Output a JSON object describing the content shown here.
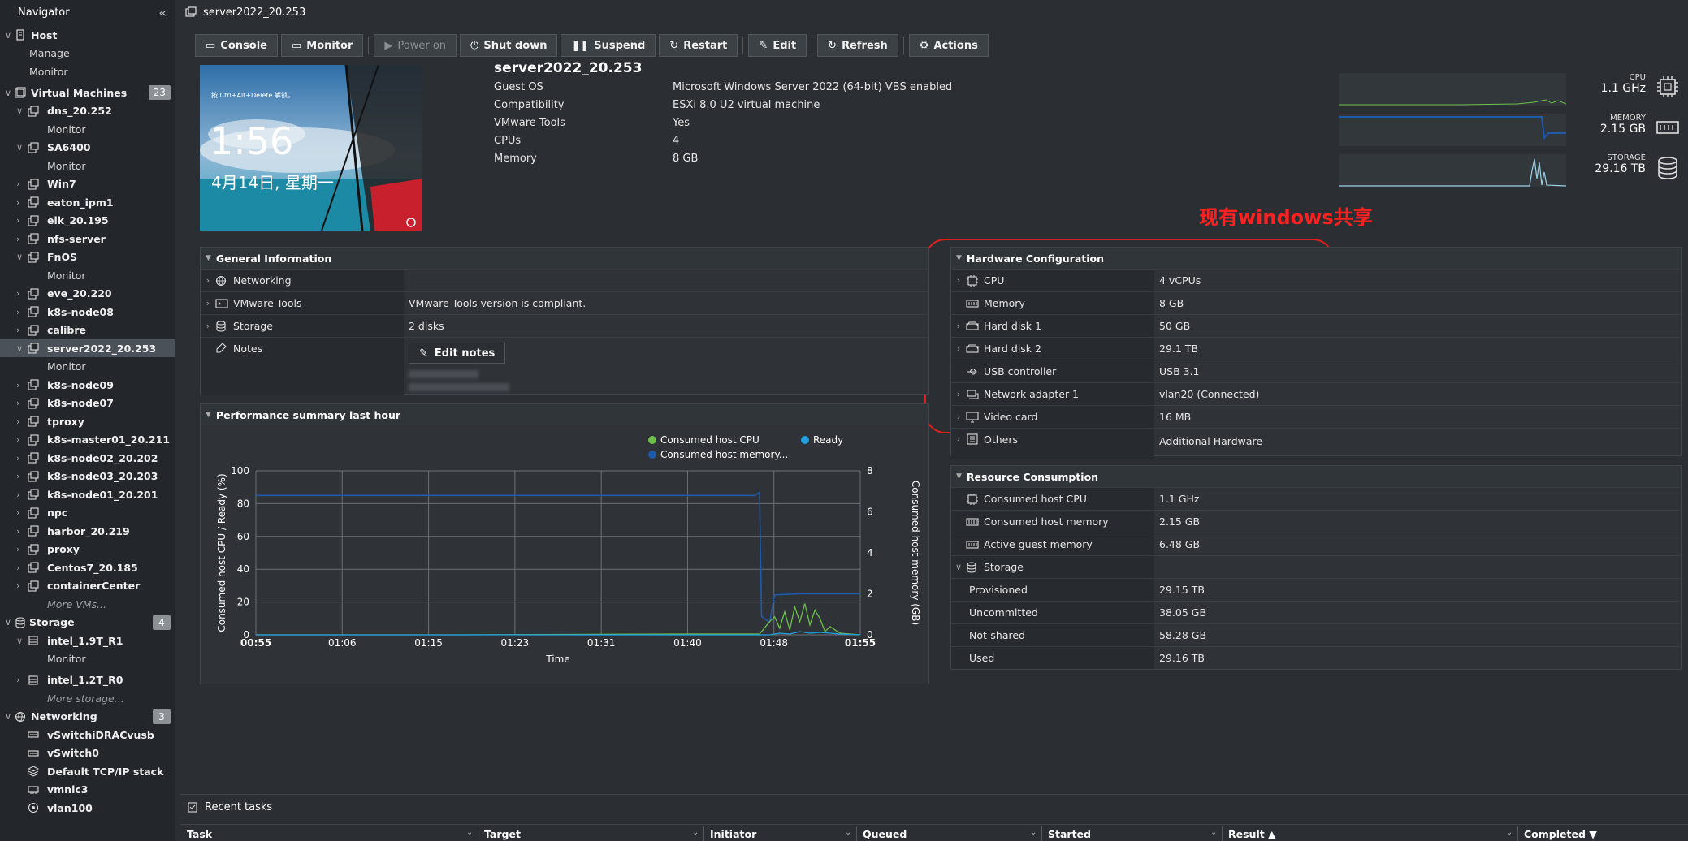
{
  "navigator": {
    "title": "Navigator",
    "host": {
      "label": "Host",
      "manage": "Manage",
      "monitor": "Monitor"
    },
    "vm_section": {
      "label": "Virtual Machines",
      "count": "23"
    },
    "vms": [
      {
        "label": "dns_20.252",
        "sub": "Monitor"
      },
      {
        "label": "SA6400",
        "sub": "Monitor"
      },
      {
        "label": "Win7"
      },
      {
        "label": "eaton_ipm1"
      },
      {
        "label": "elk_20.195"
      },
      {
        "label": "nfs-server"
      },
      {
        "label": "FnOS",
        "sub": "Monitor"
      },
      {
        "label": "eve_20.220"
      },
      {
        "label": "k8s-node08"
      },
      {
        "label": "calibre"
      },
      {
        "label": "server2022_20.253",
        "sub": "Monitor"
      },
      {
        "label": "k8s-node09"
      },
      {
        "label": "k8s-node07"
      },
      {
        "label": "tproxy"
      },
      {
        "label": "k8s-master01_20.211"
      },
      {
        "label": "k8s-node02_20.202"
      },
      {
        "label": "k8s-node03_20.203"
      },
      {
        "label": "k8s-node01_20.201"
      },
      {
        "label": "npc"
      },
      {
        "label": "harbor_20.219"
      },
      {
        "label": "proxy"
      },
      {
        "label": "Centos7_20.185"
      },
      {
        "label": "containerCenter"
      }
    ],
    "more_vms": "More VMs...",
    "storage_section": {
      "label": "Storage",
      "count": "4"
    },
    "datastores": [
      {
        "label": "intel_1.9T_R1",
        "sub": "Monitor"
      },
      {
        "label": "intel_1.2T_R0"
      }
    ],
    "more_storage": "More storage...",
    "networking_section": {
      "label": "Networking",
      "count": "3"
    },
    "networks": [
      "vSwitchiDRACvusb",
      "vSwitch0",
      "Default TCP/IP stack",
      "vmnic3",
      "vlan100"
    ]
  },
  "page": {
    "title": "server2022_20.253"
  },
  "toolbar": {
    "console": "Console",
    "monitor": "Monitor",
    "power_on": "Power on",
    "shut_down": "Shut down",
    "suspend": "Suspend",
    "restart": "Restart",
    "edit": "Edit",
    "refresh": "Refresh",
    "actions": "Actions"
  },
  "console_thumb": {
    "hint": "按 Ctrl+Alt+Delete 解锁。",
    "time": "1:56",
    "date": "4月14日, 星期一"
  },
  "summary": {
    "name": "server2022_20.253",
    "rows": [
      {
        "k": "Guest OS",
        "v": "Microsoft Windows Server 2022 (64-bit) VBS enabled"
      },
      {
        "k": "Compatibility",
        "v": "ESXi 8.0 U2 virtual machine"
      },
      {
        "k": "VMware Tools",
        "v": "Yes"
      },
      {
        "k": "CPUs",
        "v": "4"
      },
      {
        "k": "Memory",
        "v": "8 GB"
      }
    ]
  },
  "resources": {
    "cpu": {
      "label": "CPU",
      "value": "1.1 GHz"
    },
    "memory": {
      "label": "MEMORY",
      "value": "2.15 GB"
    },
    "storage": {
      "label": "STORAGE",
      "value": "29.16 TB"
    }
  },
  "annotation": "现有windows共享",
  "general": {
    "title": "General Information",
    "rows": [
      {
        "k": "Networking",
        "v": ""
      },
      {
        "k": "VMware Tools",
        "v": "VMware Tools version is compliant."
      },
      {
        "k": "Storage",
        "v": "2 disks"
      },
      {
        "k": "Notes",
        "v": ""
      }
    ],
    "edit_notes": "Edit notes"
  },
  "hardware": {
    "title": "Hardware Configuration",
    "rows": [
      {
        "k": "CPU",
        "v": "4 vCPUs"
      },
      {
        "k": "Memory",
        "v": "8 GB"
      },
      {
        "k": "Hard disk 1",
        "v": "50 GB"
      },
      {
        "k": "Hard disk 2",
        "v": "29.1 TB"
      },
      {
        "k": "USB controller",
        "v": "USB 3.1"
      },
      {
        "k": "Network adapter 1",
        "v": "vlan20 (Connected)"
      },
      {
        "k": "Video card",
        "v": "16 MB"
      },
      {
        "k": "Others",
        "v": "Additional Hardware"
      }
    ]
  },
  "resource_consumption": {
    "title": "Resource Consumption",
    "rows": [
      {
        "k": "Consumed host CPU",
        "v": "1.1 GHz"
      },
      {
        "k": "Consumed host memory",
        "v": "2.15 GB"
      },
      {
        "k": "Active guest memory",
        "v": "6.48 GB"
      },
      {
        "k": "Storage",
        "v": ""
      },
      {
        "k": "Provisioned",
        "v": "29.15 TB"
      },
      {
        "k": "Uncommitted",
        "v": "38.05 GB"
      },
      {
        "k": "Not-shared",
        "v": "58.28 GB"
      },
      {
        "k": "Used",
        "v": "29.16 TB"
      }
    ]
  },
  "performance": {
    "title": "Performance summary last hour",
    "legend": {
      "cpu": "Consumed host CPU",
      "ready": "Ready",
      "memory": "Consumed host memory..."
    },
    "colors": {
      "cpu": "#6cc04a",
      "ready": "#1ea0e0",
      "memory": "#1f5aa8"
    }
  },
  "chart_data": {
    "type": "line",
    "title": "",
    "xlabel": "Time",
    "ylabel": "Consumed host CPU / Ready (%)",
    "y2label": "Consumed host memory (GB)",
    "x_ticks": [
      "00:55",
      "01:06",
      "01:15",
      "01:23",
      "01:31",
      "01:40",
      "01:48",
      "01:55"
    ],
    "ylim": [
      0,
      100
    ],
    "y_ticks": [
      0,
      20,
      40,
      60,
      80,
      100
    ],
    "y2lim": [
      0,
      8
    ],
    "y2_ticks": [
      0,
      2,
      4,
      6,
      8
    ],
    "x_range_minutes": [
      0,
      60
    ],
    "series": [
      {
        "name": "Consumed host memory...",
        "axis": "right",
        "x": [
          0,
          49.5,
          50.0,
          50.2,
          51.0,
          51.5,
          54.0,
          60
        ],
        "y": [
          6.8,
          6.8,
          6.95,
          0.9,
          0.6,
          1.95,
          2.0,
          2.0
        ]
      },
      {
        "name": "Consumed host CPU",
        "axis": "left",
        "x": [
          0,
          20,
          43,
          50,
          51,
          51.5,
          52,
          52.5,
          53,
          53.5,
          54,
          54.5,
          55,
          55.5,
          56,
          56.5,
          57,
          58,
          60
        ],
        "y": [
          0,
          0,
          0.5,
          0.5,
          8,
          11,
          4,
          14,
          3,
          17,
          8,
          19,
          6,
          15,
          10,
          2,
          5,
          1,
          0
        ]
      },
      {
        "name": "Ready",
        "axis": "left",
        "x": [
          0,
          51,
          52,
          53,
          54,
          55,
          56,
          58,
          60
        ],
        "y": [
          0,
          0,
          1,
          0.5,
          2,
          1,
          1.5,
          0.5,
          0
        ]
      }
    ],
    "grid": true
  },
  "recent_tasks": {
    "title": "Recent tasks",
    "columns": [
      "Task",
      "Target",
      "Initiator",
      "Queued",
      "Started",
      "Result ▲",
      "Completed ▼"
    ]
  }
}
